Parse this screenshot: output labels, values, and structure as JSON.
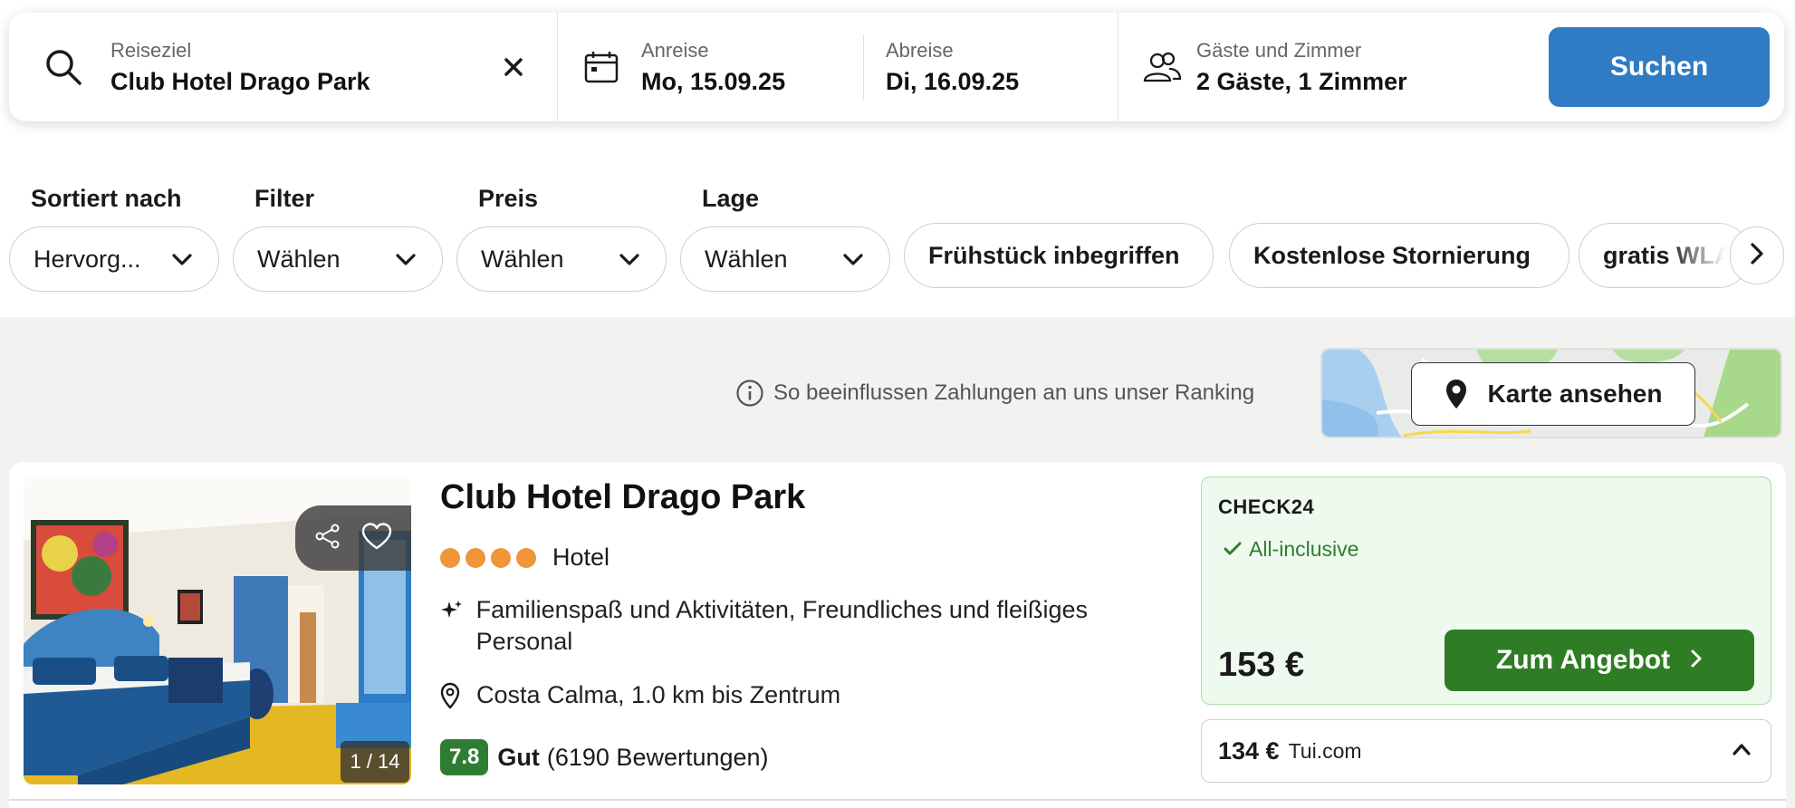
{
  "search": {
    "destination_label": "Reiseziel",
    "destination_value": "Club Hotel Drago Park",
    "checkin_label": "Anreise",
    "checkin_value": "Mo, 15.09.25",
    "checkout_label": "Abreise",
    "checkout_value": "Di, 16.09.25",
    "guests_label": "Gäste und Zimmer",
    "guests_value": "2 Gäste, 1 Zimmer",
    "search_button": "Suchen",
    "icons": [
      "search-icon",
      "close-icon",
      "calendar-icon",
      "guests-icon"
    ]
  },
  "filters": {
    "groups": [
      {
        "label": "Sortiert nach",
        "value": "Hervorg..."
      },
      {
        "label": "Filter",
        "value": "Wählen"
      },
      {
        "label": "Preis",
        "value": "Wählen"
      },
      {
        "label": "Lage",
        "value": "Wählen"
      }
    ],
    "chips": [
      "Frühstück inbegriffen",
      "Kostenlose Stornierung",
      "gratis WLAN"
    ]
  },
  "ranking_info": "So beeinflussen Zahlungen an uns unser Ranking",
  "map": {
    "button_label": "Karte ansehen"
  },
  "hotel": {
    "name": "Club Hotel Drago Park",
    "stars": 4,
    "type": "Hotel",
    "highlights": "Familienspaß und Aktivitäten, Freundliches und fleißiges Personal",
    "location": "Costa Calma, 1.0 km bis Zentrum",
    "rating_score": "7.8",
    "rating_word": "Gut",
    "rating_count": "(6190 Bewertungen)",
    "photo_counter": "1 / 14",
    "offer": {
      "provider": "CHECK24",
      "board": "All-inclusive",
      "price": "153 €",
      "button": "Zum Angebot"
    },
    "alt_offer": {
      "price": "134 €",
      "provider": "Tui.com"
    }
  },
  "colors": {
    "primary_blue": "#2f7bc4",
    "offer_green": "#2e7d24",
    "star_orange": "#f0953a",
    "rating_green": "#2e7d32"
  }
}
